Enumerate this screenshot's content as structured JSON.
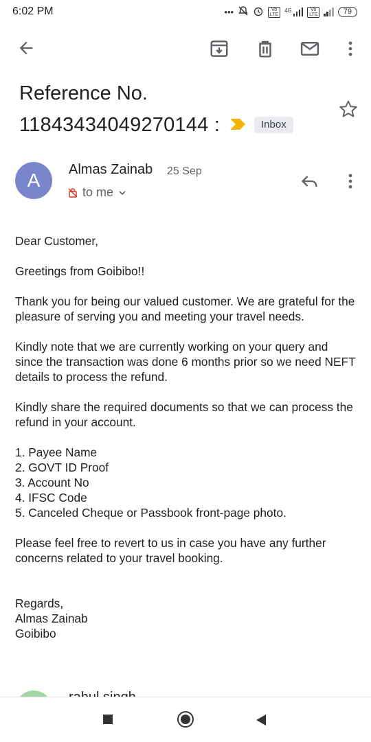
{
  "status_bar": {
    "time": "6:02 PM",
    "dots": "•••",
    "network_4g": "4G",
    "volte1": "Vo LTE",
    "volte2": "Vo LTE",
    "battery": "79"
  },
  "toolbar": {
    "back_icon": "arrow-left-icon",
    "archive_icon": "archive-icon",
    "delete_icon": "trash-icon",
    "mark_unread_icon": "mail-icon",
    "more_icon": "more-vert-icon"
  },
  "email": {
    "subject_line1": "Reference No.",
    "subject_line2": "11843434049270144 :",
    "label": "Inbox",
    "sender": "Almas Zainab",
    "avatar_letter": "A",
    "date": "25 Sep",
    "recipient": "to me",
    "body": [
      "Dear Customer,",
      "Greetings from Goibibo!!",
      "Thank you for being our valued customer. We are grateful for the pleasure of serving you and meeting your travel needs.",
      "Kindly note that we are currently working on your query and since the transaction was done 6 months prior so we need NEFT details to process the refund.",
      "Kindly share the required documents so that we can process the refund in your account."
    ],
    "list": [
      "1. Payee Name",
      "2. GOVT ID Proof",
      "3. Account No",
      "4. IFSC Code",
      "5. Canceled Cheque or Passbook front-page photo."
    ],
    "closing": "Please feel free to revert to us in case you have any further concerns related to your travel booking.",
    "signature": [
      "Regards,",
      "Almas Zainab",
      "Goibibo"
    ]
  },
  "next_message": {
    "sender": "rahul singh"
  },
  "colors": {
    "avatar": "#7986cb",
    "important_marker": "#f4b400",
    "chip_bg": "#e8eaed"
  }
}
